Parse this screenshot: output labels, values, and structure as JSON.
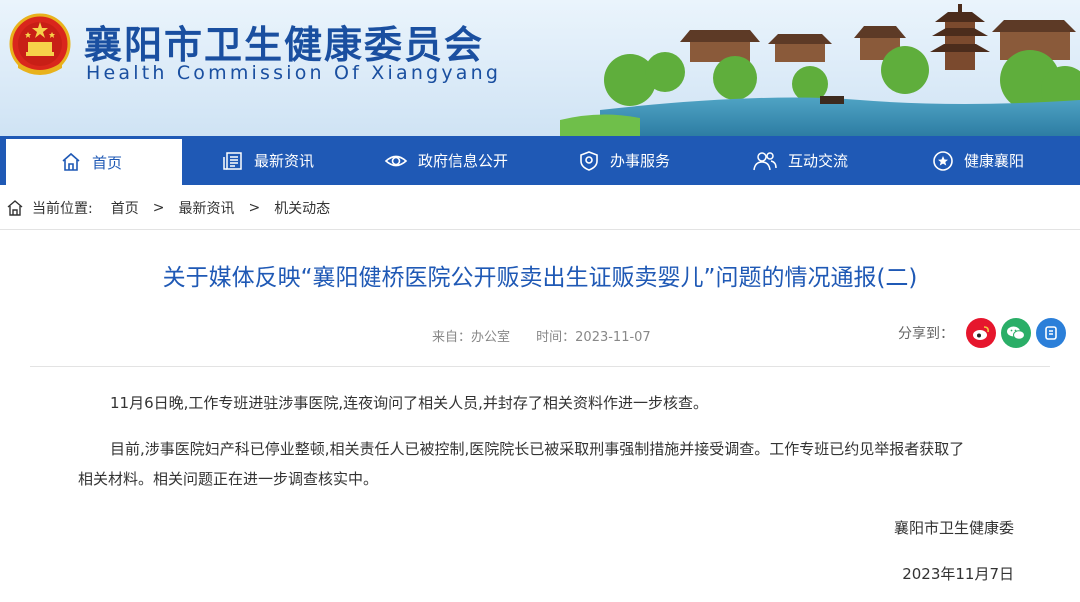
{
  "header": {
    "title": "襄阳市卫生健康委员会",
    "subtitle": "Health Commission Of Xiangyang"
  },
  "nav": {
    "items": [
      {
        "label": "首页",
        "icon": "home-icon",
        "active": true
      },
      {
        "label": "最新资讯",
        "icon": "news-icon"
      },
      {
        "label": "政府信息公开",
        "icon": "eye-icon"
      },
      {
        "label": "办事服务",
        "icon": "shield-icon"
      },
      {
        "label": "互动交流",
        "icon": "people-icon"
      },
      {
        "label": "健康襄阳",
        "icon": "badge-icon"
      }
    ]
  },
  "breadcrumb": {
    "prefix": "当前位置:",
    "items": [
      "首页",
      "最新资讯",
      "机关动态"
    ],
    "separator": ">"
  },
  "article": {
    "title": "关于媒体反映“襄阳健桥医院公开贩卖出生证贩卖婴儿”问题的情况通报(二)",
    "source": "来自：办公室",
    "time": "时间：2023-11-07",
    "share_label": "分享到：",
    "paragraphs": [
      "11月6日晚,工作专班进驻涉事医院,连夜询问了相关人员,并封存了相关资料作进一步核查。",
      "目前,涉事医院妇产科已停业整顿,相关责任人已被控制,医院院长已被采取刑事强制措施并接受调查。工作专班已约见举报者获取了",
      "相关材料。相关问题正在进一步调查核实中。"
    ],
    "signature": "襄阳市卫生健康委",
    "date": "2023年11月7日"
  },
  "share_buttons": [
    {
      "name": "weibo",
      "color": "#e6162d"
    },
    {
      "name": "wechat",
      "color": "#2aae67"
    },
    {
      "name": "qzone",
      "color": "#2b7fd9"
    }
  ],
  "colors": {
    "brand_blue": "#1f59b5",
    "title_blue": "#1a4fa0"
  }
}
